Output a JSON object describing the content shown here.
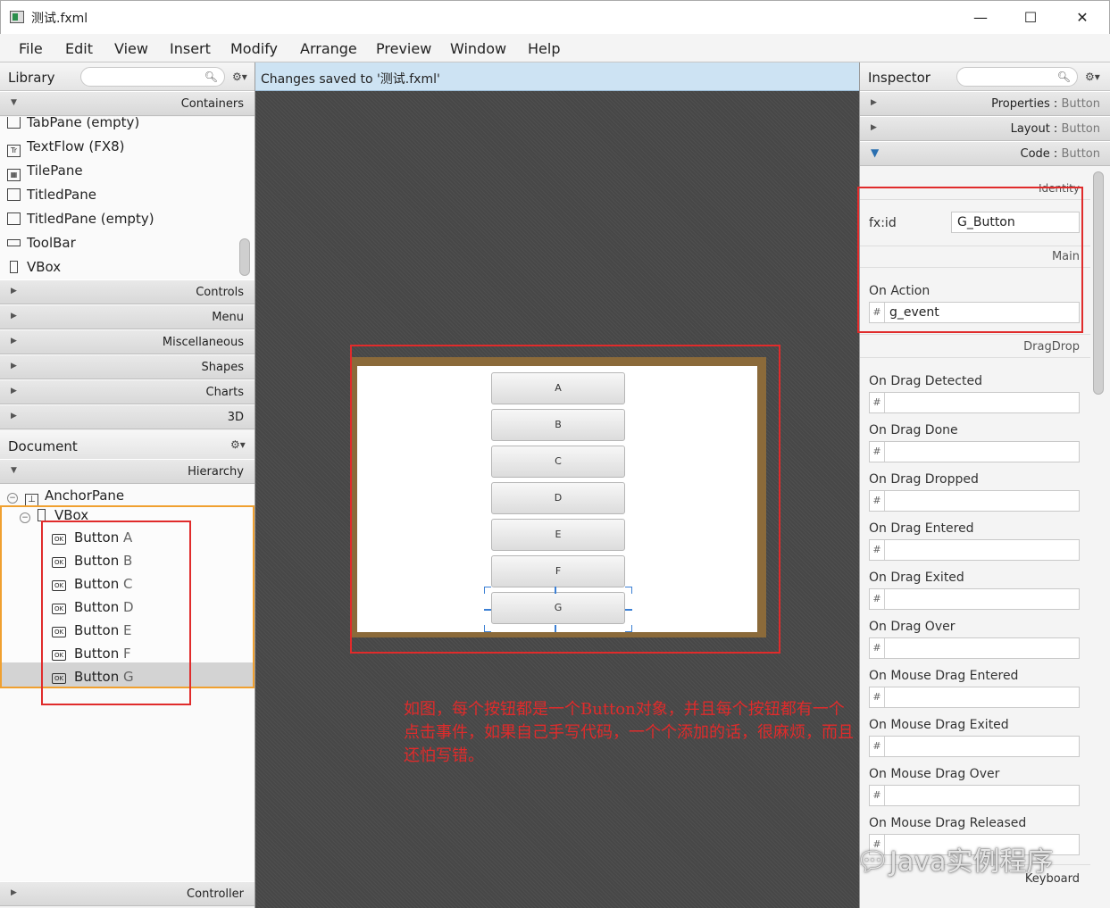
{
  "window": {
    "title": "测试.fxml",
    "min": "—",
    "max": "☐",
    "close": "✕"
  },
  "menu": [
    "File",
    "Edit",
    "View",
    "Insert",
    "Modify",
    "Arrange",
    "Preview",
    "Window",
    "Help"
  ],
  "library": {
    "title": "Library",
    "sections": {
      "containers": "Containers",
      "controls": "Controls",
      "menu": "Menu",
      "misc": "Miscellaneous",
      "shapes": "Shapes",
      "charts": "Charts",
      "d3": "3D"
    },
    "items": [
      {
        "label": "TabPane  (empty)",
        "icon": "tabpane-icon"
      },
      {
        "label": "TextFlow  (FX8)",
        "icon": "textflow-icon"
      },
      {
        "label": "TilePane",
        "icon": "tilepane-icon"
      },
      {
        "label": "TitledPane",
        "icon": "titledpane-icon"
      },
      {
        "label": "TitledPane  (empty)",
        "icon": "titledpane-icon"
      },
      {
        "label": "ToolBar",
        "icon": "toolbar-icon"
      },
      {
        "label": "VBox",
        "icon": "vbox-icon"
      }
    ]
  },
  "document": {
    "title": "Document",
    "hierarchy": "Hierarchy",
    "controller": "Controller",
    "tree": {
      "root": "AnchorPane",
      "vbox": "VBox",
      "buttons": [
        {
          "type": "Button",
          "name": "A"
        },
        {
          "type": "Button",
          "name": "B"
        },
        {
          "type": "Button",
          "name": "C"
        },
        {
          "type": "Button",
          "name": "D"
        },
        {
          "type": "Button",
          "name": "E"
        },
        {
          "type": "Button",
          "name": "F"
        },
        {
          "type": "Button",
          "name": "G"
        }
      ]
    }
  },
  "status": "Changes saved to '测试.fxml'",
  "stage_buttons": [
    "A",
    "B",
    "C",
    "D",
    "E",
    "F",
    "G"
  ],
  "note": "如图，每个按钮都是一个Button对象，并且每个按钮都有一个点击事件，如果自己手写代码，一个个添加的话，很麻烦，而且还怕写错。",
  "inspector": {
    "title": "Inspector",
    "properties": {
      "name": "Properties",
      "sep": " : ",
      "target": "Button"
    },
    "layout": {
      "name": "Layout",
      "sep": " : ",
      "target": "Button"
    },
    "code": {
      "name": "Code",
      "sep": " : ",
      "target": "Button"
    },
    "identity": "Identity",
    "fxid_label": "fx:id",
    "fxid_value": "G_Button",
    "main": "Main",
    "on_action_label": "On Action",
    "on_action_value": "g_event",
    "dragdrop": "DragDrop",
    "events": [
      "On Drag Detected",
      "On Drag Done",
      "On Drag Dropped",
      "On Drag Entered",
      "On Drag Exited",
      "On Drag Over",
      "On Mouse Drag Entered",
      "On Mouse Drag Exited",
      "On Mouse Drag Over",
      "On Mouse Drag Released"
    ],
    "keyboard": "Keyboard",
    "hash": "#"
  },
  "watermark": "Java实例程序",
  "colors": {
    "annotation_red": "#e02b2b",
    "selection_orange": "#f0a030",
    "status_blue": "#cde3f3",
    "stage_border": "#8b6a3a"
  }
}
